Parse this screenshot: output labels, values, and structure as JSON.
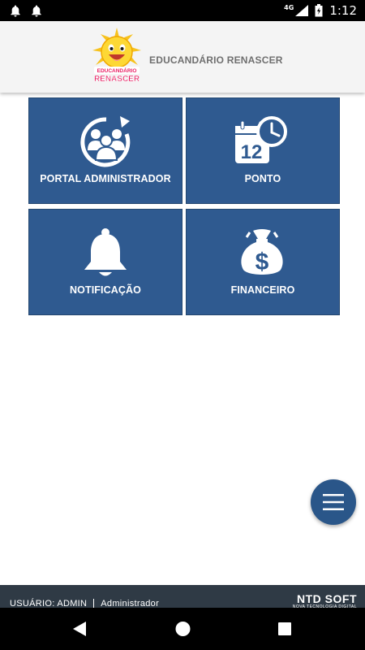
{
  "status_bar": {
    "left_icons": [
      "notification-bell-icon",
      "notification-bell-icon"
    ],
    "network": "4G",
    "time": "1:12"
  },
  "header": {
    "logo_line1": "EDUCANDÁRIO",
    "logo_line2": "RENASCER",
    "title": "EDUCANDÁRIO RENASCER"
  },
  "tiles": [
    {
      "label": "PORTAL ADMINISTRADOR",
      "icon": "admin-people-icon"
    },
    {
      "label": "PONTO",
      "icon": "calendar-clock-icon",
      "calendar_day": "12"
    },
    {
      "label": "NOTIFICAÇÃO",
      "icon": "bell-icon"
    },
    {
      "label": "FINANCEIRO",
      "icon": "money-bag-icon",
      "symbol": "$"
    }
  ],
  "fab": {
    "icon": "menu-icon"
  },
  "footer": {
    "user_label": "USUÁRIO:",
    "user_name": "ADMIN",
    "role": "Administrador",
    "brand_name": "NTD SOFT",
    "brand_tagline": "NOVA TECNOLOGIA DIGITAL"
  },
  "nav": {
    "back": "back-icon",
    "home": "home-icon",
    "recents": "recents-icon"
  },
  "colors": {
    "tile": "#2f5a90",
    "fab": "#2a5689",
    "footer": "#2f3a45",
    "header": "#f4f4f4"
  }
}
